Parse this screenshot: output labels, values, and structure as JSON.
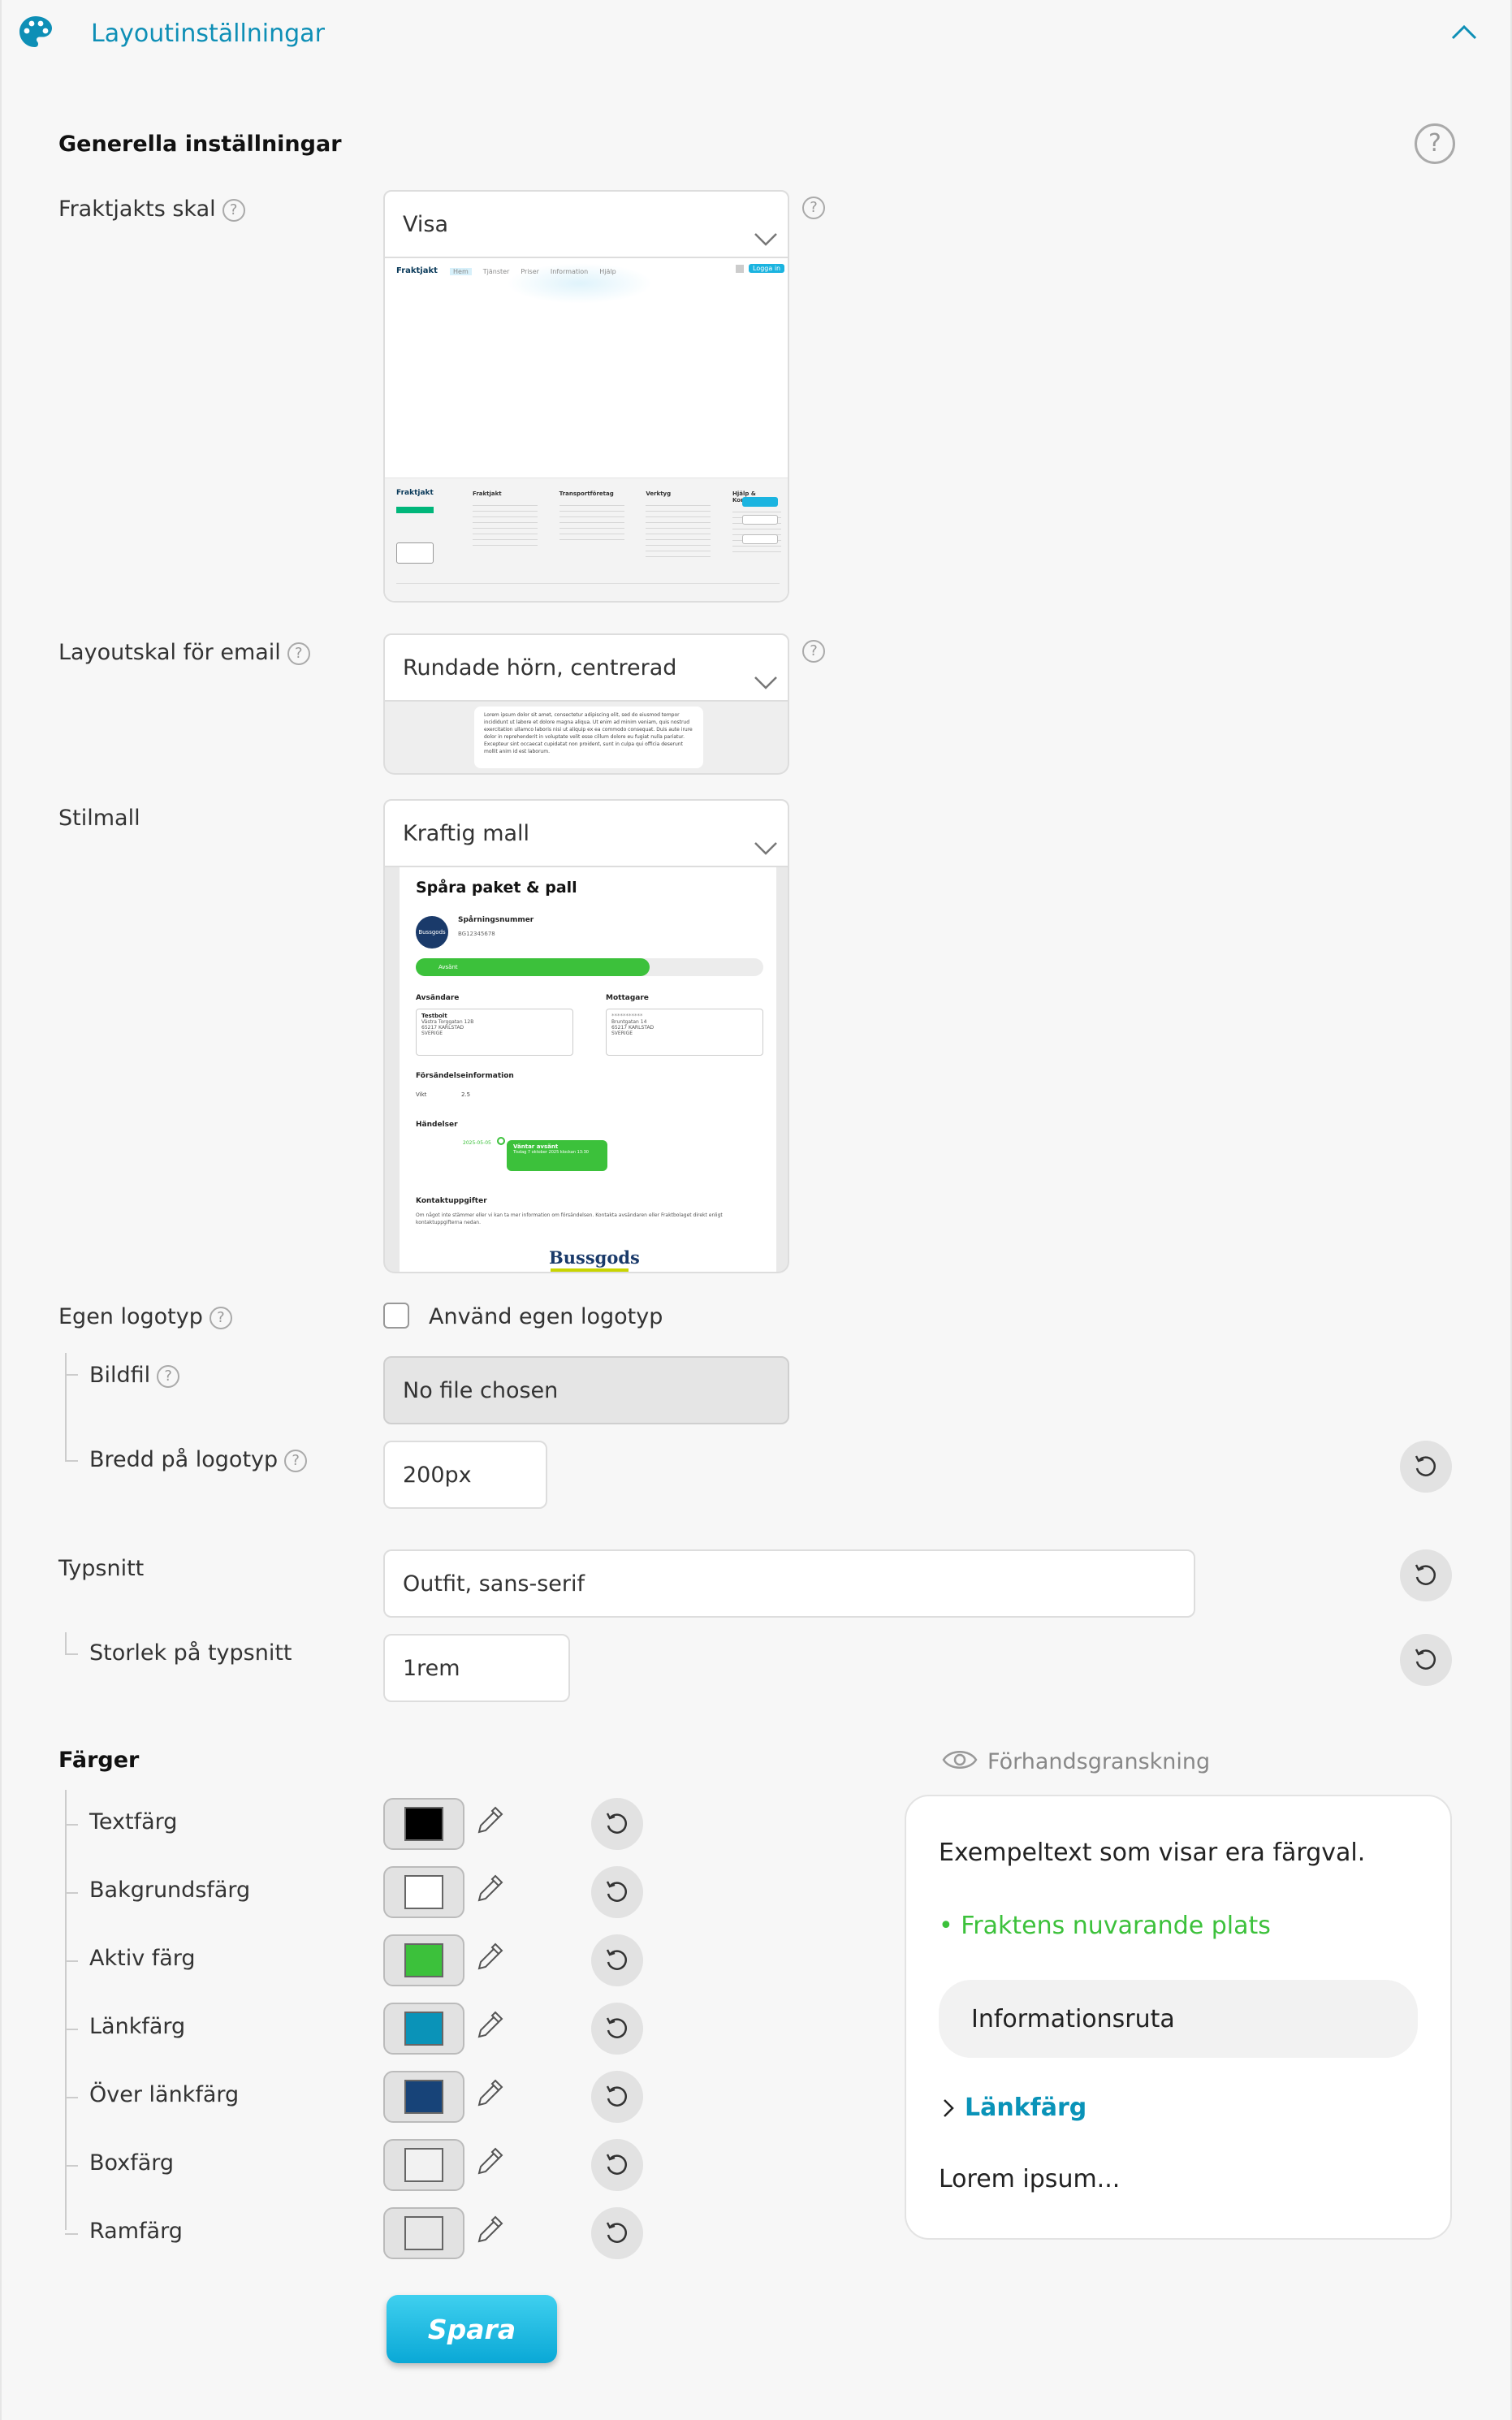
{
  "header": {
    "title": "Layoutinställningar"
  },
  "general": {
    "title": "Generella inställningar"
  },
  "shell": {
    "label": "Fraktjakts skal",
    "value": "Visa",
    "preview": {
      "logo": "Fraktjakt",
      "nav": [
        "Hem",
        "Tjänster",
        "Priser",
        "Information",
        "Hjälp"
      ],
      "login_button": "Logga in",
      "footer_logo": "Fraktjakt",
      "footer_cols": [
        "Fraktjakt",
        "Transportföretag",
        "Verktyg",
        "Hjälp & Kontakt"
      ]
    }
  },
  "email_shell": {
    "label": "Layoutskal för email",
    "value": "Rundade hörn, centrerad",
    "preview_text": "Lorem ipsum dolor sit amet, consectetur adipiscing elit, sed do eiusmod tempor incididunt ut labore et dolore magna aliqua. Ut enim ad minim veniam, quis nostrud exercitation ullamco laboris nisi ut aliquip ex ea commodo consequat. Duis aute irure dolor in reprehenderit in voluptate velit esse cillum dolore eu fugiat nulla pariatur. Excepteur sint occaecat cupidatat non proident, sunt in culpa qui officia deserunt mollit anim id est laborum."
  },
  "style": {
    "label": "Stilmall",
    "value": "Kraftig mall",
    "preview": {
      "title": "Spåra paket & pall",
      "tracking_label": "Spårningsnummer",
      "tracking_number": "BG12345678",
      "status": "Avsänt",
      "sender_label": "Avsändare",
      "sender_name": "Testbolt",
      "sender_lines": [
        "Västra Torggatan 12B",
        "65217 KARLSTAD",
        "SVERIGE"
      ],
      "receiver_label": "Mottagare",
      "receiver_name": "***********",
      "receiver_lines": [
        "Bruntgatan 14",
        "65217 KARLSTAD",
        "SVERIGE"
      ],
      "shipment_label": "Försändelseinformation",
      "weight_label": "Vikt",
      "weight_value": "2.5",
      "events_label": "Händelser",
      "event_date": "2025-05-05",
      "event_title": "Väntar avsänt",
      "event_sub": "Tisdag 7 oktober 2025 klockan 13:30",
      "contact_label": "Kontaktuppgifter",
      "contact_text": "Om något inte stämmer eller vi kan ta mer information om försändelsen. Kontakta avsändaren eller Fraktbolaget direkt enligt kontaktuppgifterna nedan.",
      "brand_badge": "Bussgods",
      "brand": "Bussgods"
    }
  },
  "logo": {
    "label": "Egen logotyp",
    "checkbox_label": "Använd egen logotyp",
    "file_label": "Bildfil",
    "file_value": "No file chosen",
    "width_label": "Bredd på logotyp",
    "width_value": "200px"
  },
  "font": {
    "label": "Typsnitt",
    "value": "Outfit, sans-serif",
    "size_label": "Storlek på typsnitt",
    "size_value": "1rem"
  },
  "colors": {
    "title": "Färger",
    "items": [
      {
        "label": "Textfärg",
        "color": "#000000"
      },
      {
        "label": "Bakgrundsfärg",
        "color": "#ffffff"
      },
      {
        "label": "Aktiv färg",
        "color": "#3cc13b"
      },
      {
        "label": "Länkfärg",
        "color": "#0a93b8"
      },
      {
        "label": "Över länkfärg",
        "color": "#174378"
      },
      {
        "label": "Boxfärg",
        "color": "#f2f2f2"
      },
      {
        "label": "Ramfärg",
        "color": "#e8e8e8"
      }
    ]
  },
  "preview": {
    "title": "Förhandsgranskning",
    "sample_text": "Exempeltext som visar era färgval.",
    "active_text": "• Fraktens nuvarande plats",
    "info_box": "Informationsruta",
    "link_text": "Länkfärg",
    "lorem": "Lorem ipsum..."
  },
  "save_label": "Spara",
  "theme": {
    "accent": "#0e8fb6",
    "active": "#3cc13b",
    "link": "#0a93b8"
  }
}
